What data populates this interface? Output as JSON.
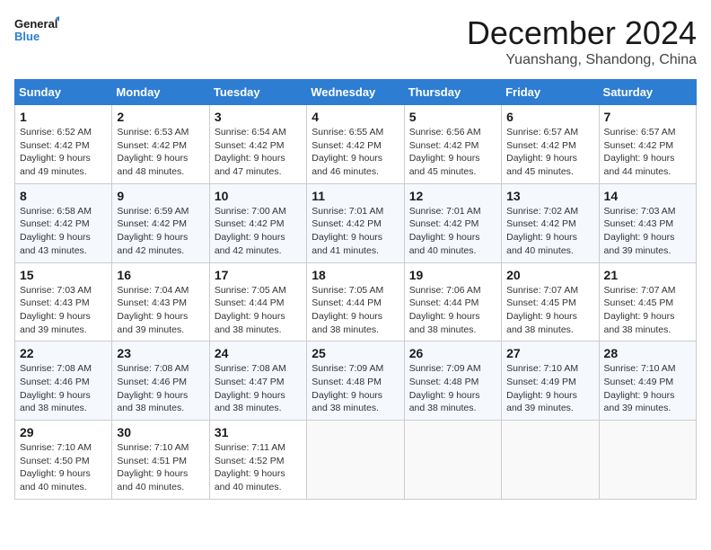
{
  "logo": {
    "line1": "General",
    "line2": "Blue"
  },
  "title": "December 2024",
  "location": "Yuanshang, Shandong, China",
  "days_of_week": [
    "Sunday",
    "Monday",
    "Tuesday",
    "Wednesday",
    "Thursday",
    "Friday",
    "Saturday"
  ],
  "weeks": [
    [
      {
        "day": 1,
        "sunrise": "6:52 AM",
        "sunset": "4:42 PM",
        "daylight": "9 hours and 49 minutes."
      },
      {
        "day": 2,
        "sunrise": "6:53 AM",
        "sunset": "4:42 PM",
        "daylight": "9 hours and 48 minutes."
      },
      {
        "day": 3,
        "sunrise": "6:54 AM",
        "sunset": "4:42 PM",
        "daylight": "9 hours and 47 minutes."
      },
      {
        "day": 4,
        "sunrise": "6:55 AM",
        "sunset": "4:42 PM",
        "daylight": "9 hours and 46 minutes."
      },
      {
        "day": 5,
        "sunrise": "6:56 AM",
        "sunset": "4:42 PM",
        "daylight": "9 hours and 45 minutes."
      },
      {
        "day": 6,
        "sunrise": "6:57 AM",
        "sunset": "4:42 PM",
        "daylight": "9 hours and 45 minutes."
      },
      {
        "day": 7,
        "sunrise": "6:57 AM",
        "sunset": "4:42 PM",
        "daylight": "9 hours and 44 minutes."
      }
    ],
    [
      {
        "day": 8,
        "sunrise": "6:58 AM",
        "sunset": "4:42 PM",
        "daylight": "9 hours and 43 minutes."
      },
      {
        "day": 9,
        "sunrise": "6:59 AM",
        "sunset": "4:42 PM",
        "daylight": "9 hours and 42 minutes."
      },
      {
        "day": 10,
        "sunrise": "7:00 AM",
        "sunset": "4:42 PM",
        "daylight": "9 hours and 42 minutes."
      },
      {
        "day": 11,
        "sunrise": "7:01 AM",
        "sunset": "4:42 PM",
        "daylight": "9 hours and 41 minutes."
      },
      {
        "day": 12,
        "sunrise": "7:01 AM",
        "sunset": "4:42 PM",
        "daylight": "9 hours and 40 minutes."
      },
      {
        "day": 13,
        "sunrise": "7:02 AM",
        "sunset": "4:42 PM",
        "daylight": "9 hours and 40 minutes."
      },
      {
        "day": 14,
        "sunrise": "7:03 AM",
        "sunset": "4:43 PM",
        "daylight": "9 hours and 39 minutes."
      }
    ],
    [
      {
        "day": 15,
        "sunrise": "7:03 AM",
        "sunset": "4:43 PM",
        "daylight": "9 hours and 39 minutes."
      },
      {
        "day": 16,
        "sunrise": "7:04 AM",
        "sunset": "4:43 PM",
        "daylight": "9 hours and 39 minutes."
      },
      {
        "day": 17,
        "sunrise": "7:05 AM",
        "sunset": "4:44 PM",
        "daylight": "9 hours and 38 minutes."
      },
      {
        "day": 18,
        "sunrise": "7:05 AM",
        "sunset": "4:44 PM",
        "daylight": "9 hours and 38 minutes."
      },
      {
        "day": 19,
        "sunrise": "7:06 AM",
        "sunset": "4:44 PM",
        "daylight": "9 hours and 38 minutes."
      },
      {
        "day": 20,
        "sunrise": "7:07 AM",
        "sunset": "4:45 PM",
        "daylight": "9 hours and 38 minutes."
      },
      {
        "day": 21,
        "sunrise": "7:07 AM",
        "sunset": "4:45 PM",
        "daylight": "9 hours and 38 minutes."
      }
    ],
    [
      {
        "day": 22,
        "sunrise": "7:08 AM",
        "sunset": "4:46 PM",
        "daylight": "9 hours and 38 minutes."
      },
      {
        "day": 23,
        "sunrise": "7:08 AM",
        "sunset": "4:46 PM",
        "daylight": "9 hours and 38 minutes."
      },
      {
        "day": 24,
        "sunrise": "7:08 AM",
        "sunset": "4:47 PM",
        "daylight": "9 hours and 38 minutes."
      },
      {
        "day": 25,
        "sunrise": "7:09 AM",
        "sunset": "4:48 PM",
        "daylight": "9 hours and 38 minutes."
      },
      {
        "day": 26,
        "sunrise": "7:09 AM",
        "sunset": "4:48 PM",
        "daylight": "9 hours and 38 minutes."
      },
      {
        "day": 27,
        "sunrise": "7:10 AM",
        "sunset": "4:49 PM",
        "daylight": "9 hours and 39 minutes."
      },
      {
        "day": 28,
        "sunrise": "7:10 AM",
        "sunset": "4:49 PM",
        "daylight": "9 hours and 39 minutes."
      }
    ],
    [
      {
        "day": 29,
        "sunrise": "7:10 AM",
        "sunset": "4:50 PM",
        "daylight": "9 hours and 40 minutes."
      },
      {
        "day": 30,
        "sunrise": "7:10 AM",
        "sunset": "4:51 PM",
        "daylight": "9 hours and 40 minutes."
      },
      {
        "day": 31,
        "sunrise": "7:11 AM",
        "sunset": "4:52 PM",
        "daylight": "9 hours and 40 minutes."
      },
      null,
      null,
      null,
      null
    ]
  ]
}
